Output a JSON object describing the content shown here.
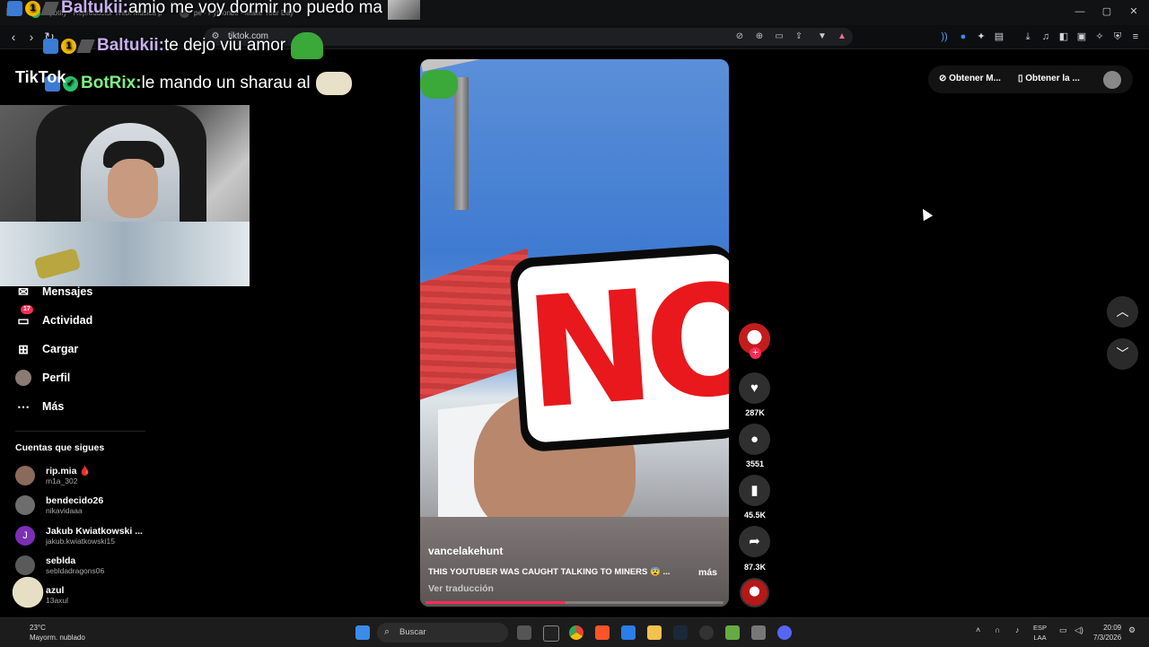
{
  "browser": {
    "tabs": [
      {
        "label": "Spotify - Reproductor Web: Música p",
        "color": "#1db954"
      },
      {
        "label": "pe - Pythonbe - Make Your Day",
        "color": "#888888"
      }
    ],
    "url": "tiktok.com"
  },
  "chat": [
    {
      "user": "Baltukii:",
      "text": "amio me voy dormir no puedo ma",
      "user_color": "#c8aef0"
    },
    {
      "user": "Baltukii:",
      "text": "te dejo viu amor",
      "user_color": "#c8aef0"
    },
    {
      "user": "BotRix:",
      "text": "le mando un sharau al",
      "user_color": "#7ef07e"
    }
  ],
  "tiktok": {
    "logo": "TikTok",
    "nav": [
      {
        "label": "Mensajes",
        "icon": "messages-icon",
        "badge": ""
      },
      {
        "label": "Actividad",
        "icon": "activity-icon",
        "badge": "17"
      },
      {
        "label": "Cargar",
        "icon": "upload-icon",
        "badge": ""
      },
      {
        "label": "Perfil",
        "icon": "profile-icon",
        "badge": ""
      },
      {
        "label": "Más",
        "icon": "more-icon",
        "badge": ""
      }
    ],
    "following_title": "Cuentas que sigues",
    "following": [
      {
        "name": "rip.mia 🩸",
        "handle": "m1a_302",
        "avatar_color": "#8a6a5a"
      },
      {
        "name": "bendecido26",
        "handle": "nikavidaaa",
        "avatar_color": "#6d6d6d"
      },
      {
        "name": "Jakub Kwiatkowski ...",
        "handle": "jakub.kwiatkowski15",
        "avatar_color": "#7b2fb5"
      },
      {
        "name": "seblda",
        "handle": "sebldadragons06",
        "avatar_color": "#5a5a5a"
      },
      {
        "name": "azul",
        "handle": "13axul",
        "avatar_color": "#444444"
      }
    ]
  },
  "video": {
    "overlay_text": "NO",
    "username": "vancelakehunt",
    "caption": "THIS YOUTUBER WAS CAUGHT TALKING TO MINERS 😨 ...",
    "more": "más",
    "translate": "Ver traducción",
    "progress": 0.47
  },
  "actions": {
    "likes": "287K",
    "comments": "3551",
    "saves": "45.5K",
    "shares": "87.3K"
  },
  "topright": {
    "btn1": "Obtener M...",
    "btn2": "Obtener la ..."
  },
  "taskbar": {
    "temp": "23°C",
    "weather": "Mayorm. nublado",
    "search": "Buscar",
    "lang1": "ESP",
    "lang2": "LAA",
    "time": "20:09",
    "date": "7/3/2026"
  },
  "colors": {
    "accent": "#fe2c55",
    "background": "#000000"
  }
}
